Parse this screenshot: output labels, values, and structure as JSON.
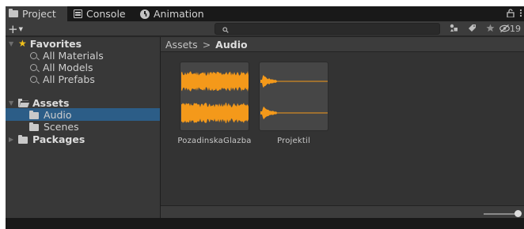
{
  "tabs": [
    {
      "label": "Project",
      "icon": "folder-icon",
      "active": true
    },
    {
      "label": "Console",
      "icon": "console-icon",
      "active": false
    },
    {
      "label": "Animation",
      "icon": "animation-icon",
      "active": false
    }
  ],
  "tab_tools": {
    "lock_icon": "lock-icon",
    "menu_icon": "kebab-menu-icon"
  },
  "toolbar": {
    "add_label": "+",
    "search_placeholder": "",
    "icons": [
      "filter-by-type-icon",
      "filter-by-label-icon",
      "favorite-star-icon"
    ],
    "hidden_count": "19"
  },
  "tree": {
    "favorites": {
      "label": "Favorites",
      "items": [
        "All Materials",
        "All Models",
        "All Prefabs"
      ]
    },
    "assets": {
      "label": "Assets",
      "children": [
        "Audio",
        "Scenes"
      ],
      "selected": "Audio"
    },
    "packages": {
      "label": "Packages"
    }
  },
  "breadcrumb": {
    "root": "Assets",
    "separator": ">",
    "current": "Audio"
  },
  "assets": [
    {
      "name": "PozadinskaGlazba",
      "type": "audio-clip",
      "waveform": "full"
    },
    {
      "name": "Projektil",
      "type": "audio-clip",
      "waveform": "short"
    }
  ],
  "zoom_slider": {
    "value": 1.0
  },
  "colors": {
    "waveform": "#f4991a",
    "selection": "#2c5d87",
    "favorite_star": "#f2c21b"
  }
}
